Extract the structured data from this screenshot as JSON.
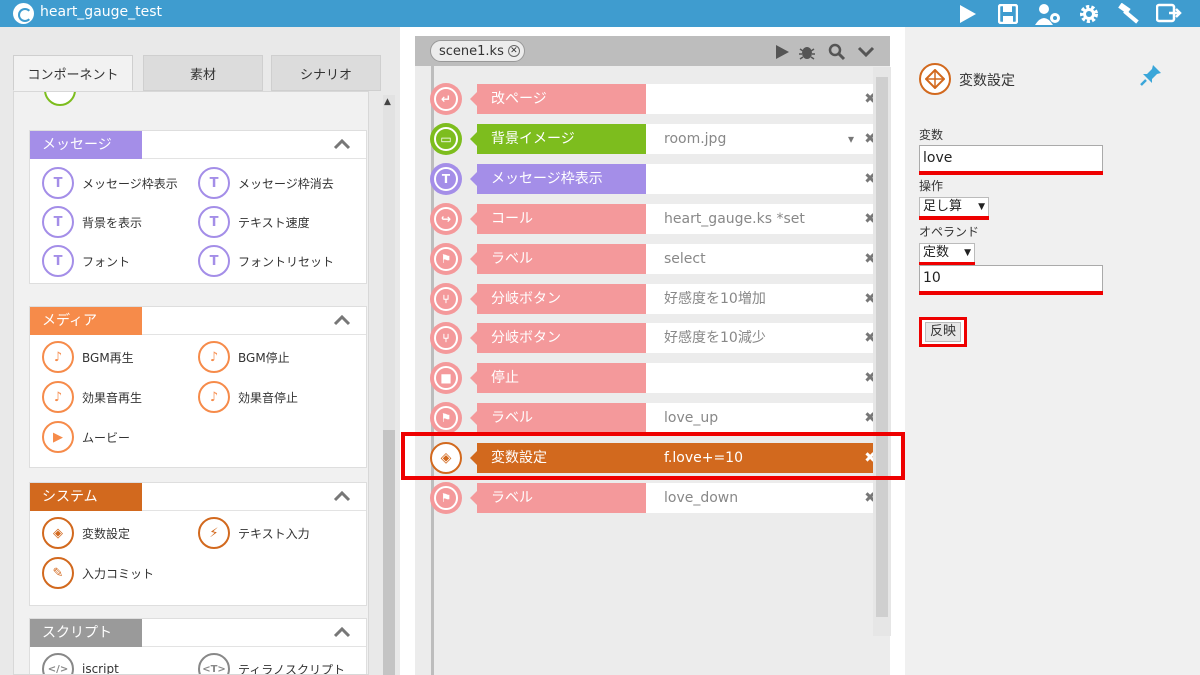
{
  "app": {
    "title": "heart_gauge_test"
  },
  "toolbar": {
    "icons": [
      "play-icon",
      "save-icon",
      "user-settings-icon",
      "gear-icon",
      "hammer-icon",
      "export-icon"
    ]
  },
  "left": {
    "tabs": [
      {
        "label": "コンポーネント",
        "active": true
      },
      {
        "label": "素材"
      },
      {
        "label": "シナリオ"
      }
    ],
    "categories": [
      {
        "title": "メッセージ",
        "color": "#a48ee8",
        "items": [
          {
            "label": "メッセージ枠表示",
            "icon": "eye-letter-icon"
          },
          {
            "label": "メッセージ枠消去",
            "icon": "eye-cross-letter-icon"
          },
          {
            "label": "背景を表示",
            "icon": "text-pointer-icon"
          },
          {
            "label": "テキスト速度",
            "icon": "text-speed-icon"
          },
          {
            "label": "フォント",
            "icon": "font-icon"
          },
          {
            "label": "フォントリセット",
            "icon": "font-reset-icon"
          }
        ]
      },
      {
        "title": "メディア",
        "color": "#f68b4a",
        "items": [
          {
            "label": "BGM再生",
            "icon": "bgm-play-icon"
          },
          {
            "label": "BGM停止",
            "icon": "bgm-stop-icon"
          },
          {
            "label": "効果音再生",
            "icon": "se-play-icon"
          },
          {
            "label": "効果音停止",
            "icon": "se-stop-icon"
          },
          {
            "label": "ムービー",
            "icon": "movie-icon"
          }
        ]
      },
      {
        "title": "システム",
        "color": "#d2691e",
        "items": [
          {
            "label": "変数設定",
            "icon": "variable-icon"
          },
          {
            "label": "テキスト入力",
            "icon": "lightning-icon"
          },
          {
            "label": "入力コミット",
            "icon": "plug-icon"
          }
        ]
      },
      {
        "title": "スクリプト",
        "color": "#9a9a9a",
        "items": [
          {
            "label": "iscript",
            "icon": "code-icon"
          },
          {
            "label": "ティラノスクリプト",
            "icon": "tag-t-icon"
          }
        ]
      }
    ]
  },
  "scene": {
    "tab": "scene1.ks",
    "rows": [
      {
        "label": "改ページ",
        "value": "",
        "color": "#f4999b",
        "icon": "page-break-icon"
      },
      {
        "label": "背景イメージ",
        "value": "room.jpg",
        "color": "#7dbd1e",
        "icon": "image-icon",
        "dropdown": true
      },
      {
        "label": "メッセージ枠表示",
        "value": "",
        "color": "#a48ee8",
        "icon": "eye-letter-icon"
      },
      {
        "label": "コール",
        "value": "heart_gauge.ks *set",
        "color": "#f4999b",
        "icon": "call-icon"
      },
      {
        "label": "ラベル",
        "value": "select",
        "color": "#f4999b",
        "icon": "flag-icon"
      },
      {
        "label": "分岐ボタン",
        "value": "好感度を10増加",
        "color": "#f4999b",
        "icon": "branch-icon"
      },
      {
        "label": "分岐ボタン",
        "value": "好感度を10減少",
        "color": "#f4999b",
        "icon": "branch-icon"
      },
      {
        "label": "停止",
        "value": "",
        "color": "#f4999b",
        "icon": "stop-icon"
      },
      {
        "label": "ラベル",
        "value": "love_up",
        "color": "#f4999b",
        "icon": "flag-icon"
      },
      {
        "label": "変数設定",
        "value": "f.love+=10",
        "color": "#d2691e",
        "icon": "variable-icon",
        "selected": true
      },
      {
        "label": "ラベル",
        "value": "love_down",
        "color": "#f4999b",
        "icon": "flag-icon"
      }
    ]
  },
  "props": {
    "title": "変数設定",
    "variable_label": "変数",
    "variable_value": "love",
    "operation_label": "操作",
    "operation_value": "足し算",
    "operand_label": "オペランド",
    "operand_type": "定数",
    "operand_value": "10",
    "apply_label": "反映"
  }
}
